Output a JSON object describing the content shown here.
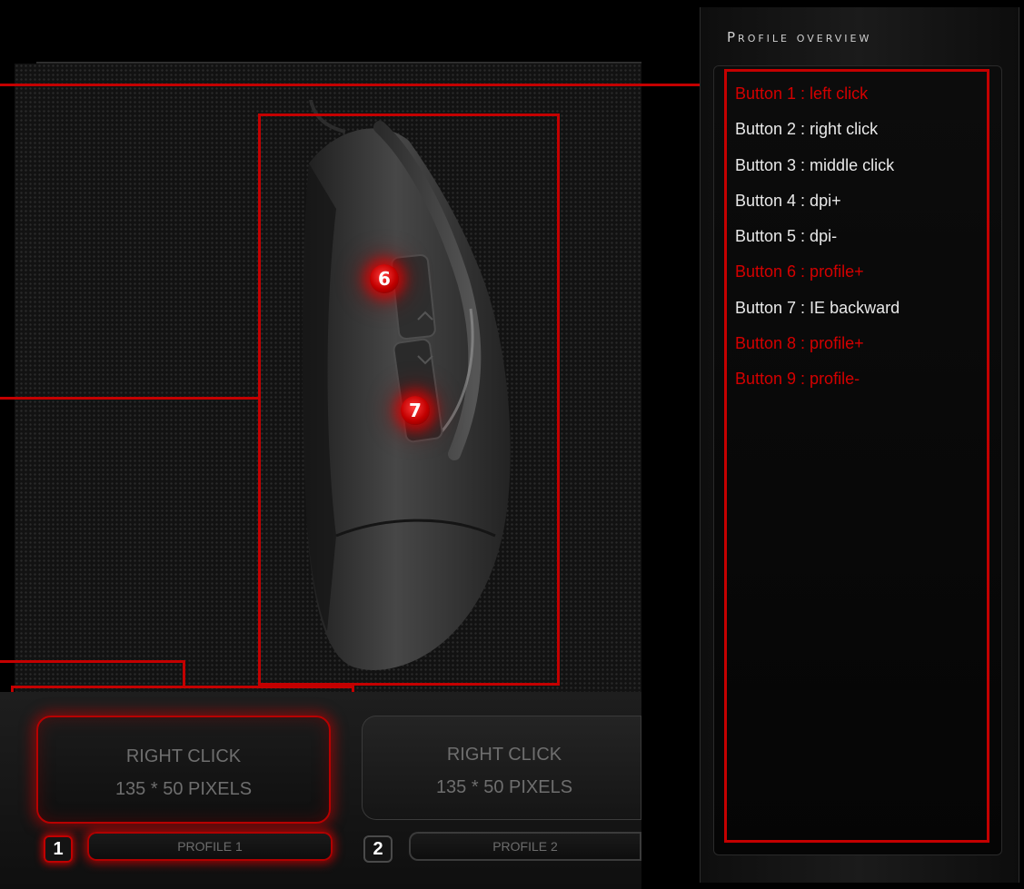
{
  "overview": {
    "title": "Profile overview",
    "items": [
      {
        "text": "Button 1 : left click",
        "active": true
      },
      {
        "text": "Button 2 : right click",
        "active": false
      },
      {
        "text": "Button 3 : middle click",
        "active": false
      },
      {
        "text": "Button 4 : dpi+",
        "active": false
      },
      {
        "text": "Button 5 : dpi-",
        "active": false
      },
      {
        "text": "Button 6 : profile+",
        "active": true
      },
      {
        "text": "Button 7 : IE backward",
        "active": false
      },
      {
        "text": "Button 8 : profile+",
        "active": true
      },
      {
        "text": "Button 9 : profile-",
        "active": true
      }
    ]
  },
  "hotspots": [
    "6",
    "7"
  ],
  "profiles": [
    {
      "action": "RIGHT CLICK",
      "size": "135 * 50 PIXELS",
      "number": "1",
      "name": "PROFILE 1",
      "selected": true
    },
    {
      "action": "RIGHT CLICK",
      "size": "135 * 50 PIXELS",
      "number": "2",
      "name": "PROFILE 2",
      "selected": false
    }
  ],
  "colors": {
    "accent": "#c40000",
    "active_text": "#d40000",
    "text": "#e9e9e9",
    "muted": "#6e6e6e"
  }
}
